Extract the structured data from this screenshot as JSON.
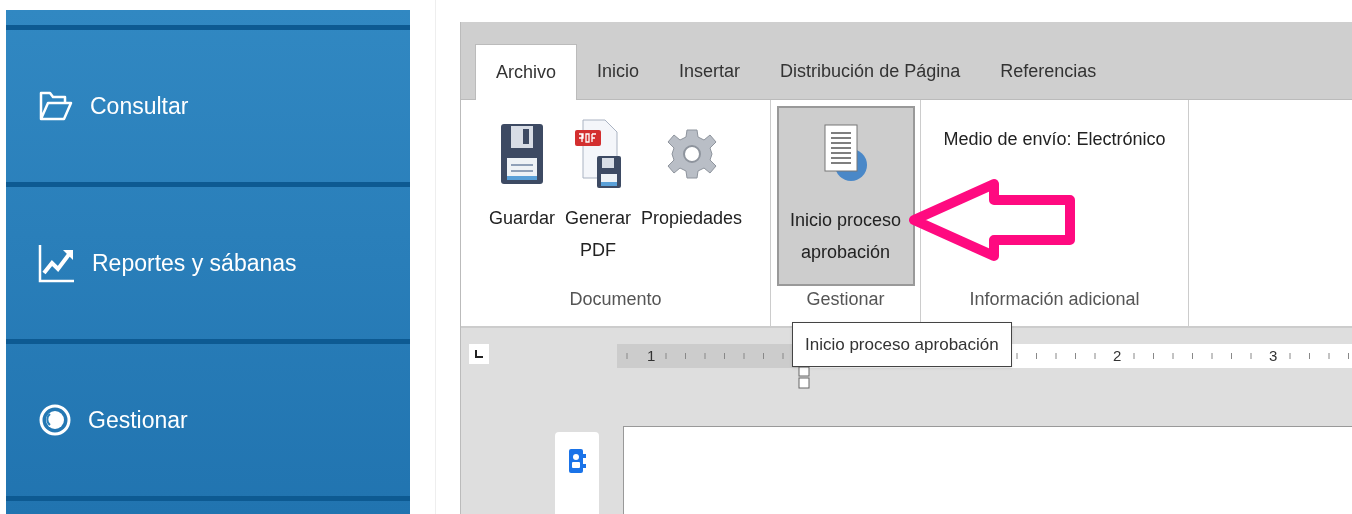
{
  "sidebar": {
    "items": [
      {
        "label": "Consultar",
        "kind": "folder"
      },
      {
        "label": "Reportes y sábanas",
        "kind": "chart"
      },
      {
        "label": "Gestionar",
        "kind": "eye"
      }
    ]
  },
  "tabs": [
    {
      "label": "Archivo",
      "selected": true
    },
    {
      "label": "Inicio",
      "selected": false
    },
    {
      "label": "Insertar",
      "selected": false
    },
    {
      "label": "Distribución de Página",
      "selected": false
    },
    {
      "label": "Referencias",
      "selected": false
    }
  ],
  "ribbon": {
    "groups": [
      {
        "label": "Documento",
        "buttons": [
          {
            "label": "Guardar",
            "kind": "save",
            "selected": false
          },
          {
            "label": "Generar PDF",
            "kind": "pdf",
            "selected": false
          },
          {
            "label": "Propiedades",
            "kind": "settings",
            "selected": false
          }
        ]
      },
      {
        "label": "Gestionar",
        "buttons": [
          {
            "label": "Inicio proceso aprobación",
            "kind": "approval",
            "selected": true
          }
        ]
      },
      {
        "label": "Información adicional",
        "info": "Medio de envío: Electrónico"
      }
    ]
  },
  "tooltip": {
    "text": "Inicio proceso aprobación"
  },
  "ruler": {
    "labels": [
      "1",
      "2",
      "3"
    ]
  }
}
